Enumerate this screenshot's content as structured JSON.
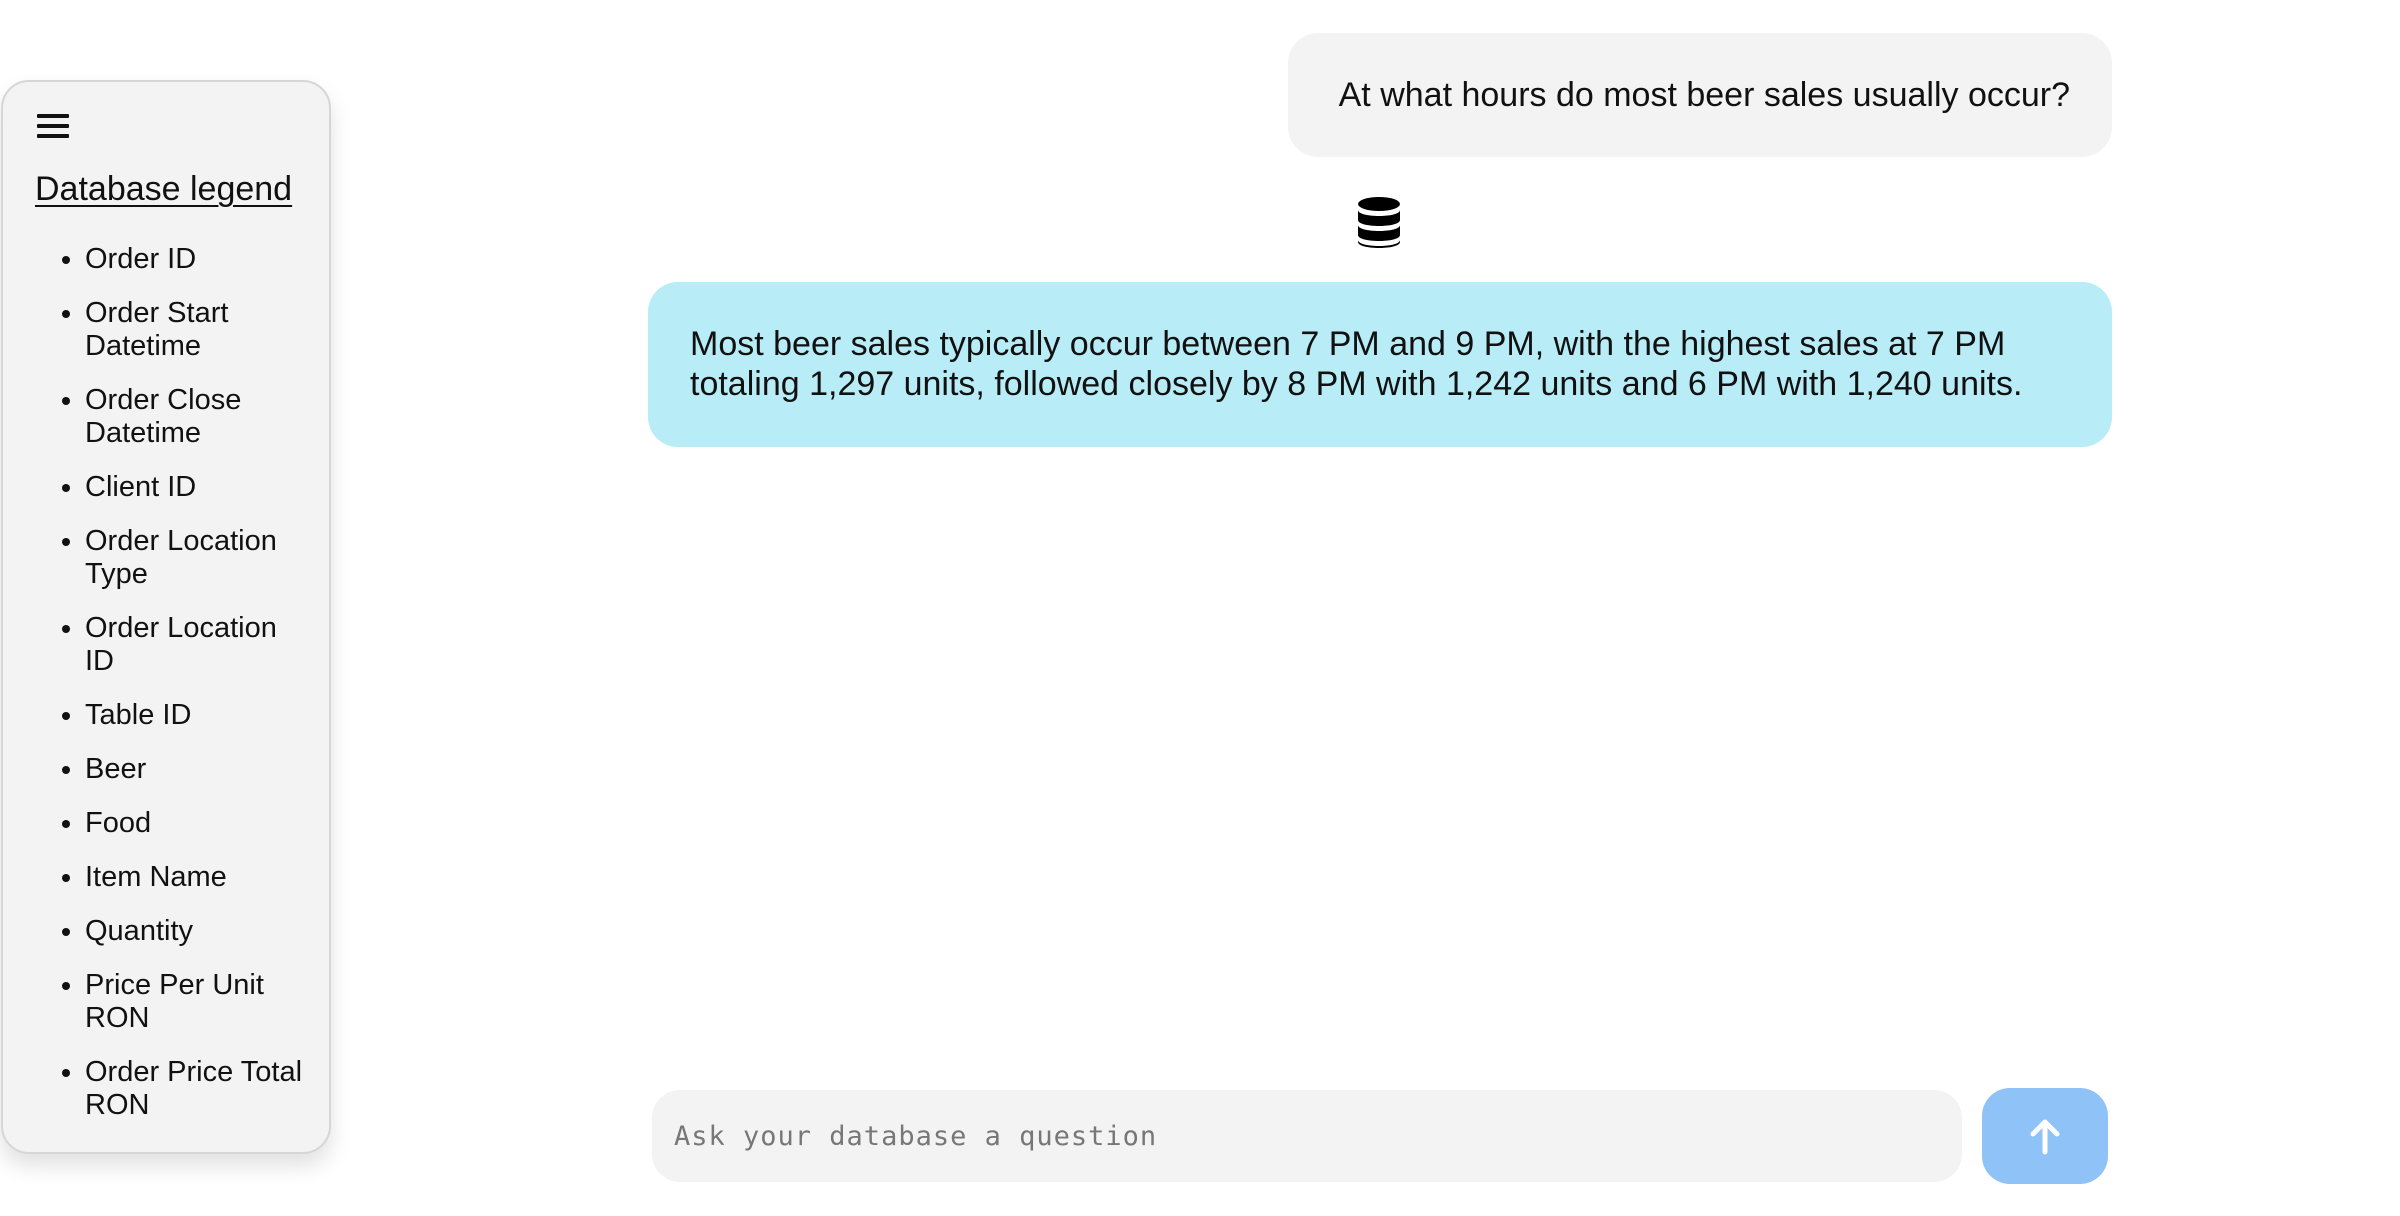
{
  "sidebar": {
    "menu_icon": "hamburger-menu-icon",
    "title": "Database legend",
    "items": [
      {
        "label": "Order ID"
      },
      {
        "label": "Order Start Datetime"
      },
      {
        "label": "Order Close Datetime"
      },
      {
        "label": "Client ID"
      },
      {
        "label": "Order Location Type"
      },
      {
        "label": "Order Location ID"
      },
      {
        "label": "Table ID"
      },
      {
        "label": "Beer"
      },
      {
        "label": "Food"
      },
      {
        "label": "Item Name"
      },
      {
        "label": "Quantity"
      },
      {
        "label": "Price Per Unit RON"
      },
      {
        "label": "Order Price Total RON"
      }
    ]
  },
  "chat": {
    "user_message": "At what hours do most beer sales usually occur?",
    "assistant_icon": "database-icon",
    "assistant_message": "Most beer sales typically occur between 7 PM and 9 PM, with the highest sales at 7 PM totaling 1,297 units, followed closely by 8 PM with 1,242 units and 6 PM with 1,240 units."
  },
  "composer": {
    "placeholder": "Ask your database a question",
    "value": "",
    "send_icon": "arrow-up-icon"
  },
  "colors": {
    "sidebar_bg": "#f3f3f3",
    "user_bubble_bg": "#f3f3f3",
    "assistant_bubble_bg": "#b8ecf6",
    "send_button_bg": "#8fc2f7"
  }
}
